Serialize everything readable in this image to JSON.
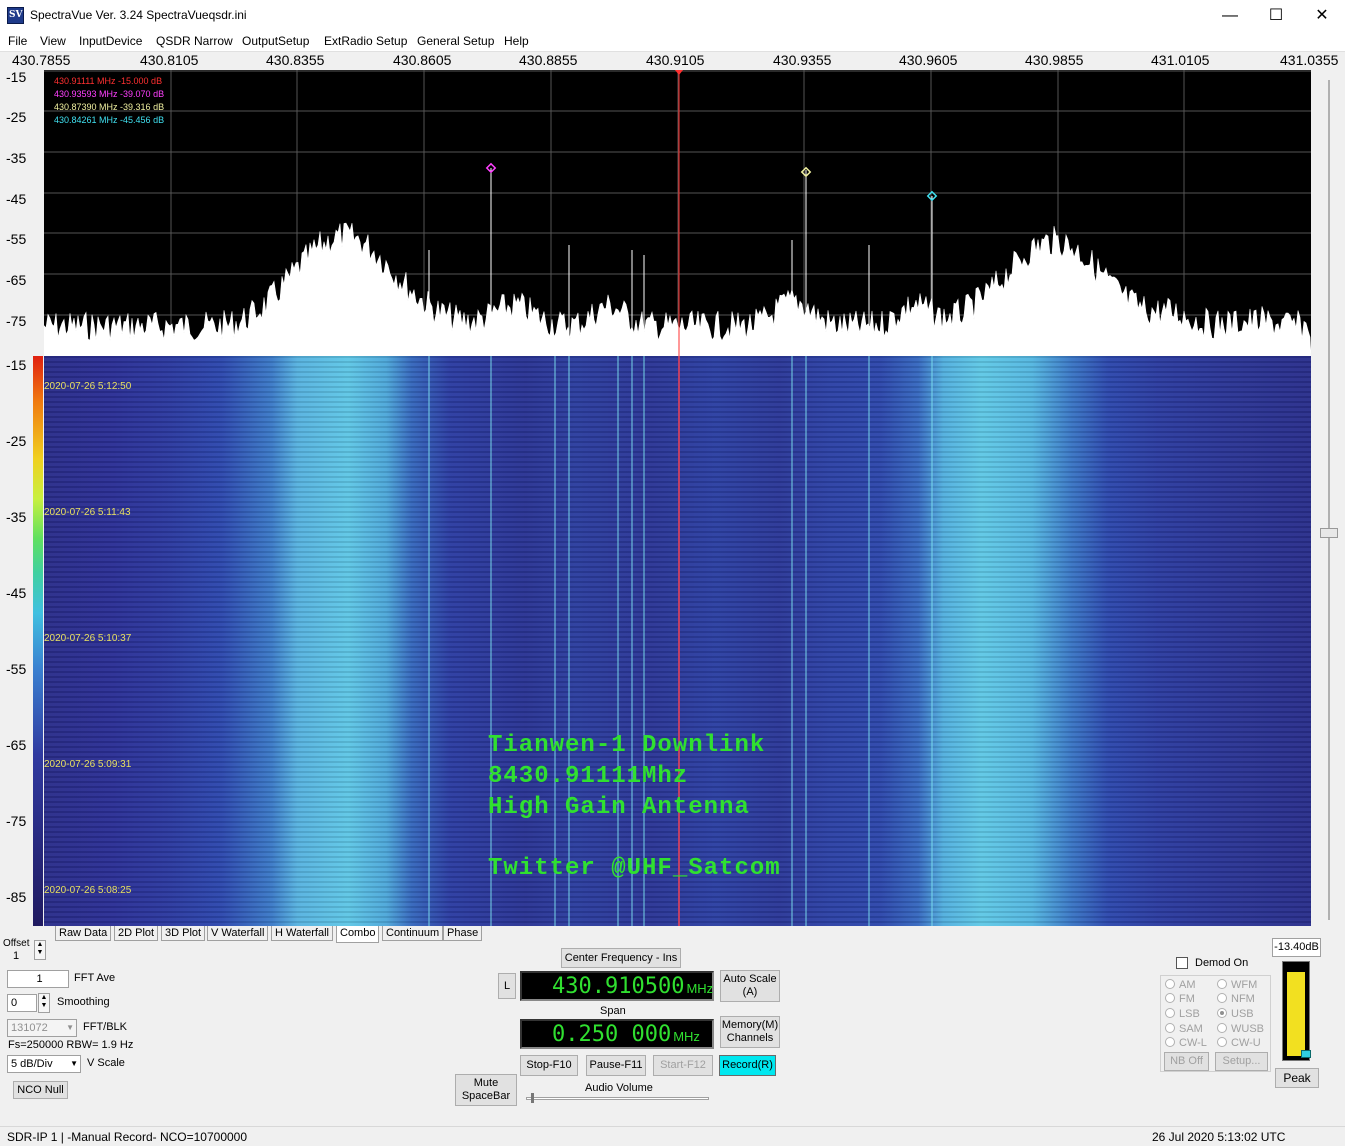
{
  "window": {
    "title": "SpectraVue Ver. 3.24  SpectraVueqsdr.ini",
    "icon_label": "SV",
    "min_glyph": "—",
    "max_glyph": "☐",
    "close_glyph": "✕"
  },
  "menu": [
    "File",
    "View",
    "InputDevice",
    "QSDR Narrow",
    "OutputSetup",
    "ExtRadio Setup",
    "General Setup",
    "Help"
  ],
  "freq_axis": [
    "430.7855",
    "430.8105",
    "430.8355",
    "430.8605",
    "430.8855",
    "430.9105",
    "430.9355",
    "430.9605",
    "430.9855",
    "431.0105",
    "431.0355"
  ],
  "spectrum": {
    "y_labels": [
      "-15",
      "-25",
      "-35",
      "-45",
      "-55",
      "-65",
      "-75"
    ],
    "markers": [
      {
        "text": "430.91111 MHz  -15.000 dB",
        "color": "#ff3030"
      },
      {
        "text": "430.93593 MHz  -39.070 dB",
        "color": "#ff40ff"
      },
      {
        "text": "430.87390 MHz  -39.316 dB",
        "color": "#f0f0a0"
      },
      {
        "text": "430.84261 MHz  -45.456 dB",
        "color": "#40e0f0"
      }
    ]
  },
  "waterfall": {
    "y_labels": [
      "-15",
      "-25",
      "-35",
      "-45",
      "-55",
      "-65",
      "-75",
      "-85"
    ],
    "timestamps": [
      "2020-07-26 5:12:50",
      "2020-07-26 5:11:43",
      "2020-07-26 5:10:37",
      "2020-07-26 5:09:31",
      "2020-07-26 5:08:25"
    ],
    "overlay": {
      "line1": "Tianwen-1 Downlink",
      "line2": "8430.91111Mhz",
      "line3": "High Gain Antenna",
      "line4": "Twitter @UHF_Satcom"
    }
  },
  "tabs": [
    "Raw Data",
    "2D Plot",
    "3D Plot",
    "V Waterfall",
    "H Waterfall",
    "Combo",
    "Continuum",
    "Phase"
  ],
  "active_tab": "Combo",
  "left_controls": {
    "offset_label": "Offset",
    "offset_value": "1",
    "fft_ave_value": "1",
    "fft_ave_label": "FFT Ave",
    "smoothing_value": "0",
    "smoothing_label": "Smoothing",
    "fft_blk_value": "131072",
    "fft_blk_label": "FFT/BLK",
    "fs_rbw": "Fs=250000 RBW= 1.9 Hz",
    "vscale_value": "5 dB/Div",
    "vscale_label": "V Scale",
    "nco_null": "NCO Null"
  },
  "center": {
    "center_freq_button": "Center Frequency - Ins",
    "l_button": "L",
    "center_freq_value": "430.910500",
    "unit_mhz": "MHz",
    "auto_scale": "Auto Scale (A)",
    "span_label": "Span",
    "span_value": "0.250 000",
    "memory_channels": "Memory(M) Channels",
    "stop": "Stop-F10",
    "pause": "Pause-F11",
    "start": "Start-F12",
    "record": "Record(R)",
    "mute": "Mute SpaceBar",
    "audio_volume": "Audio Volume",
    "audio_volume_level": 0.02
  },
  "demod": {
    "demod_on": "Demod On",
    "modes_left": [
      "AM",
      "FM",
      "LSB",
      "SAM",
      "CW-L"
    ],
    "modes_right": [
      "WFM",
      "NFM",
      "USB",
      "WUSB",
      "CW-U"
    ],
    "selected": "USB",
    "nb_off": "NB Off",
    "setup": "Setup..."
  },
  "meter": {
    "level_text": "-13.40dB",
    "peak": "Peak",
    "level_fraction": 0.95
  },
  "status": {
    "left": "SDR-IP 1  | -Manual Record-   NCO=10700000",
    "right": "26 Jul 2020  5:13:02 UTC"
  },
  "colors": {
    "lcd_green": "#30e030",
    "record_active": "#00e8f0",
    "overlay_green": "#30e030"
  }
}
